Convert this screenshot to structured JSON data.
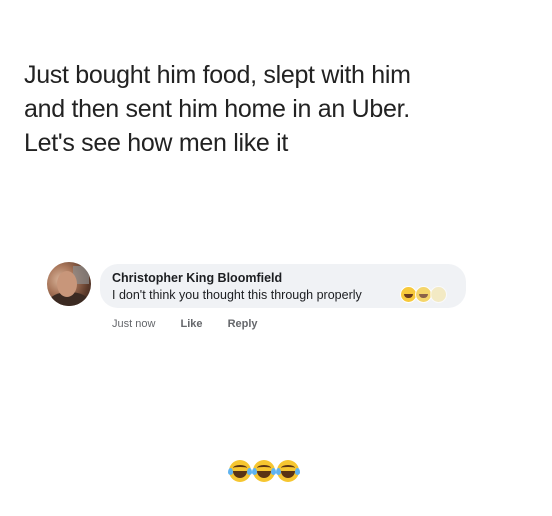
{
  "post": {
    "lines": [
      "Just bought him food, slept with him",
      "and then sent him home in an Uber.",
      "Let's see how men like it"
    ]
  },
  "comment": {
    "author": "Christopher King Bloomfield",
    "text": "I don't think you thought this through properly",
    "reaction_icons": [
      "laughing-tears-emoji",
      "laughing-tears-emoji",
      "laughing-tears-emoji"
    ],
    "actions": {
      "time": "Just now",
      "like": "Like",
      "reply": "Reply"
    }
  },
  "footer": {
    "emojis": [
      "laughing-tears-emoji",
      "laughing-tears-emoji",
      "laughing-tears-emoji"
    ]
  },
  "colors": {
    "text": "#222222",
    "bubble": "#f0f2f5",
    "meta": "#65676b",
    "emoji": "#f6c630"
  }
}
